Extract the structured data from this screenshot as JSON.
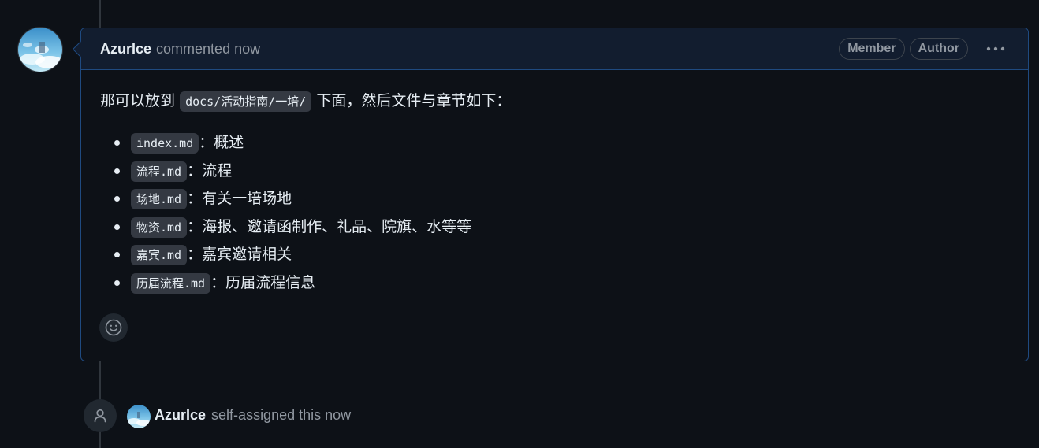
{
  "comment": {
    "author": "AzurIce",
    "action_text": "commented now",
    "badges": [
      "Member",
      "Author"
    ],
    "menu_icon": "kebab-horizontal-icon",
    "intro_before": "那可以放到",
    "intro_code": "docs/活动指南/一培/",
    "intro_after": "下面，然后文件与章节如下：",
    "items": [
      {
        "file": "index.md",
        "desc": "概述"
      },
      {
        "file": "流程.md",
        "desc": "流程"
      },
      {
        "file": "场地.md",
        "desc": "有关一培场地"
      },
      {
        "file": "物资.md",
        "desc": "海报、邀请函制作、礼品、院旗、水等等"
      },
      {
        "file": "嘉宾.md",
        "desc": "嘉宾邀请相关"
      },
      {
        "file": "历届流程.md",
        "desc": "历届流程信息"
      }
    ],
    "item_separator": "：",
    "reaction_icon": "smiley-icon"
  },
  "event": {
    "icon": "person-icon",
    "author": "AzurIce",
    "action_text": "self-assigned this now"
  },
  "colors": {
    "background": "#0d1117",
    "header_bg": "#121d2f",
    "border_accent": "#1f4a80",
    "muted_text": "#9198a1",
    "code_bg": "#343942"
  }
}
